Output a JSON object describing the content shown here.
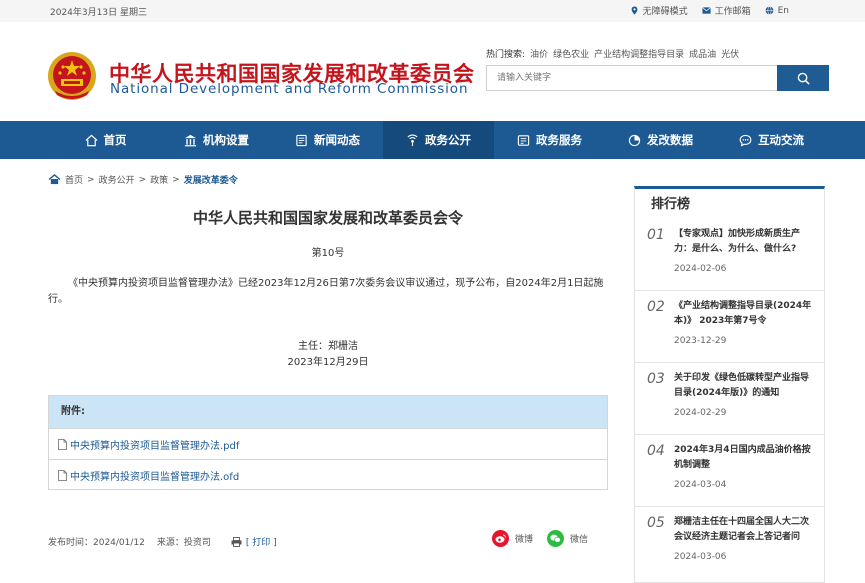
{
  "topbar": {
    "date": "2024年3月13日 星期三",
    "accessibility": "无障碍模式",
    "mail": "工作邮箱",
    "lang": "En"
  },
  "header": {
    "title_cn": "中华人民共和国国家发展和改革委员会",
    "title_en": "National Development and Reform Commission",
    "hot_label": "热门搜索:",
    "hot_terms": [
      "油价",
      "绿色农业",
      "产业结构调整指导目录",
      "成品油",
      "光伏"
    ],
    "search_placeholder": "请输入关键字"
  },
  "nav": [
    {
      "label": "首页",
      "icon": "home-icon"
    },
    {
      "label": "机构设置",
      "icon": "building-icon"
    },
    {
      "label": "新闻动态",
      "icon": "news-icon"
    },
    {
      "label": "政务公开",
      "icon": "broadcast-icon"
    },
    {
      "label": "政务服务",
      "icon": "service-icon"
    },
    {
      "label": "发改数据",
      "icon": "chart-icon"
    },
    {
      "label": "互动交流",
      "icon": "chat-icon"
    }
  ],
  "breadcrumb": [
    "首页",
    "政务公开",
    "政策",
    "发展改革委令"
  ],
  "article": {
    "title": "中华人民共和国国家发展和改革委员会令",
    "number": "第10号",
    "body": "《中央预算内投资项目监督管理办法》已经2023年12月26日第7次委务会议审议通过，现予公布，自2024年2月1日起施行。",
    "signer": "主任：郑栅洁",
    "sign_date": "2023年12月29日"
  },
  "attachments": {
    "header": "附件:",
    "files": [
      "中央预算内投资项目监督管理办法.pdf",
      "中央预算内投资项目监督管理办法.ofd"
    ]
  },
  "meta": {
    "publish": "发布时间：2024/01/12",
    "source": "来源：投资司",
    "print": "[ 打印 ]"
  },
  "share": {
    "weibo": "微博",
    "wechat": "微信"
  },
  "ranking": {
    "title": "排行榜",
    "items": [
      {
        "num": "01",
        "text": "【专家观点】加快形成新质生产力：是什么、为什么、做什么?",
        "date": "2024-02-06"
      },
      {
        "num": "02",
        "text": "《产业结构调整指导目录(2024年本)》 2023年第7号令",
        "date": "2023-12-29"
      },
      {
        "num": "03",
        "text": "关于印发《绿色低碳转型产业指导目录(2024年版)》的通知",
        "date": "2024-02-29"
      },
      {
        "num": "04",
        "text": "2024年3月4日国内成品油价格按机制调整",
        "date": "2024-03-04"
      },
      {
        "num": "05",
        "text": "郑栅洁主任在十四届全国人大二次会议经济主题记者会上答记者问",
        "date": "2024-03-06"
      }
    ]
  },
  "colors": {
    "brand_blue": "#1d5a94",
    "brand_red": "#c4151c",
    "attach_bg": "#cce5f6"
  }
}
